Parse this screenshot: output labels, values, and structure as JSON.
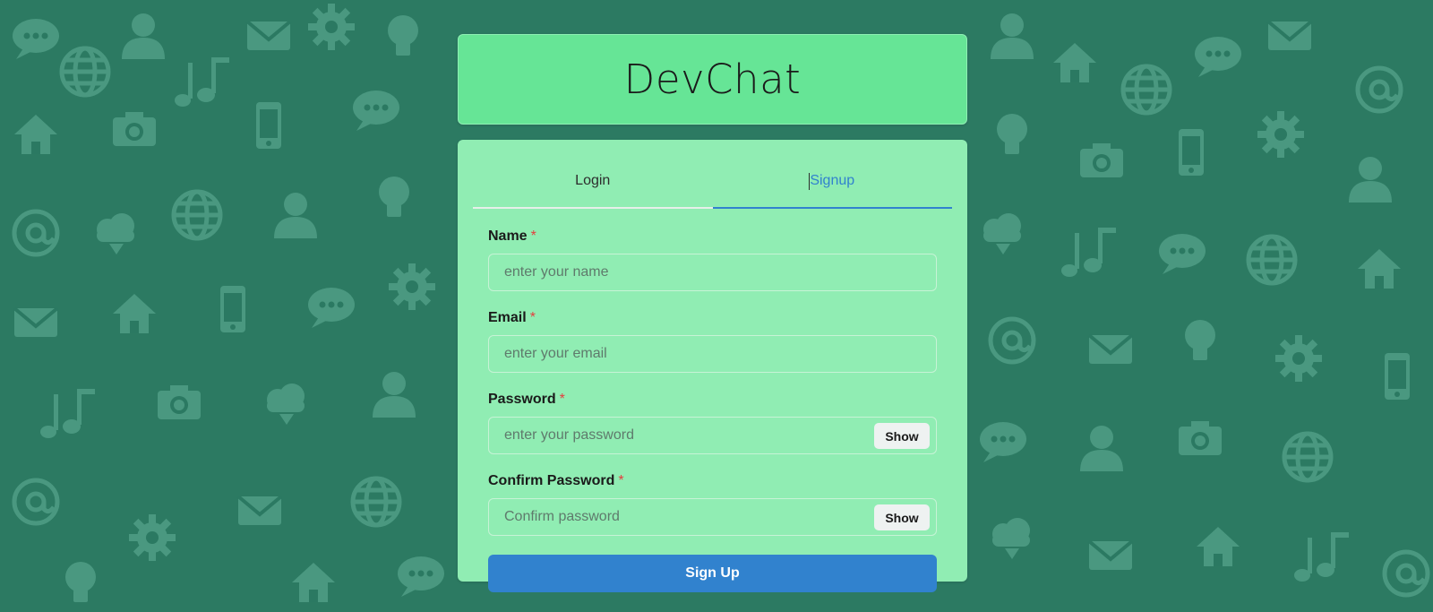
{
  "app": {
    "title": "DevChat"
  },
  "tabs": [
    {
      "label": "Login",
      "active": false
    },
    {
      "label": "Signup",
      "active": true
    }
  ],
  "form": {
    "name": {
      "label": "Name",
      "required_mark": "*",
      "placeholder": "enter your name",
      "value": ""
    },
    "email": {
      "label": "Email",
      "required_mark": "*",
      "placeholder": "enter your email",
      "value": ""
    },
    "password": {
      "label": "Password",
      "required_mark": "*",
      "placeholder": "enter your password",
      "value": "",
      "toggle_label": "Show"
    },
    "confirm_password": {
      "label": "Confirm Password",
      "required_mark": "*",
      "placeholder": "Confirm password",
      "value": "",
      "toggle_label": "Show"
    },
    "submit_label": "Sign Up"
  },
  "colors": {
    "background": "#2c7a62",
    "header_bg": "#66e596",
    "card_bg": "#90edb3",
    "accent": "#3182ce",
    "required": "#e53e3e"
  },
  "background_pattern_icons": [
    "chat-bubble-icon",
    "globe-icon",
    "envelope-icon",
    "music-note-icon",
    "person-icon",
    "cloud-download-icon",
    "gear-icon",
    "lightbulb-icon",
    "home-icon",
    "phone-icon",
    "camera-icon",
    "at-sign-icon"
  ]
}
